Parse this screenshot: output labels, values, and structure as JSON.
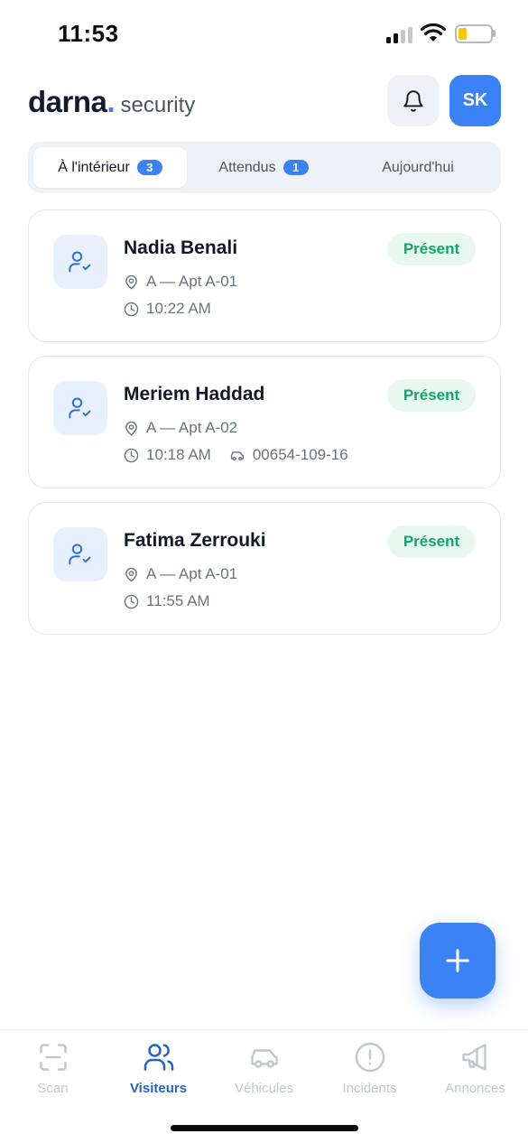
{
  "status_bar": {
    "time": "11:53"
  },
  "header": {
    "brand_name": "darna",
    "brand_dot": ".",
    "brand_sub": "security",
    "avatar_initials": "SK"
  },
  "tabs": [
    {
      "label": "À l'intérieur",
      "count": "3",
      "active": true
    },
    {
      "label": "Attendus",
      "count": "1",
      "active": false
    },
    {
      "label": "Aujourd'hui",
      "count": "",
      "active": false
    }
  ],
  "visitors": [
    {
      "name": "Nadia Benali",
      "status": "Présent",
      "location": "A — Apt A-01",
      "time": "10:22 AM",
      "plate": ""
    },
    {
      "name": "Meriem Haddad",
      "status": "Présent",
      "location": "A — Apt A-02",
      "time": "10:18 AM",
      "plate": "00654-109-16"
    },
    {
      "name": "Fatima Zerrouki",
      "status": "Présent",
      "location": "A — Apt A-01",
      "time": "11:55 AM",
      "plate": ""
    }
  ],
  "bottom_nav": [
    {
      "label": "Scan",
      "icon": "scan-icon",
      "active": false
    },
    {
      "label": "Visiteurs",
      "icon": "users-icon",
      "active": true
    },
    {
      "label": "Véhicules",
      "icon": "car-icon",
      "active": false
    },
    {
      "label": "Incidents",
      "icon": "alert-circle-icon",
      "active": false
    },
    {
      "label": "Annonces",
      "icon": "megaphone-icon",
      "active": false
    }
  ],
  "colors": {
    "accent": "#3b82f6",
    "present_text": "#16a368",
    "present_bg": "#e8f8f0"
  }
}
